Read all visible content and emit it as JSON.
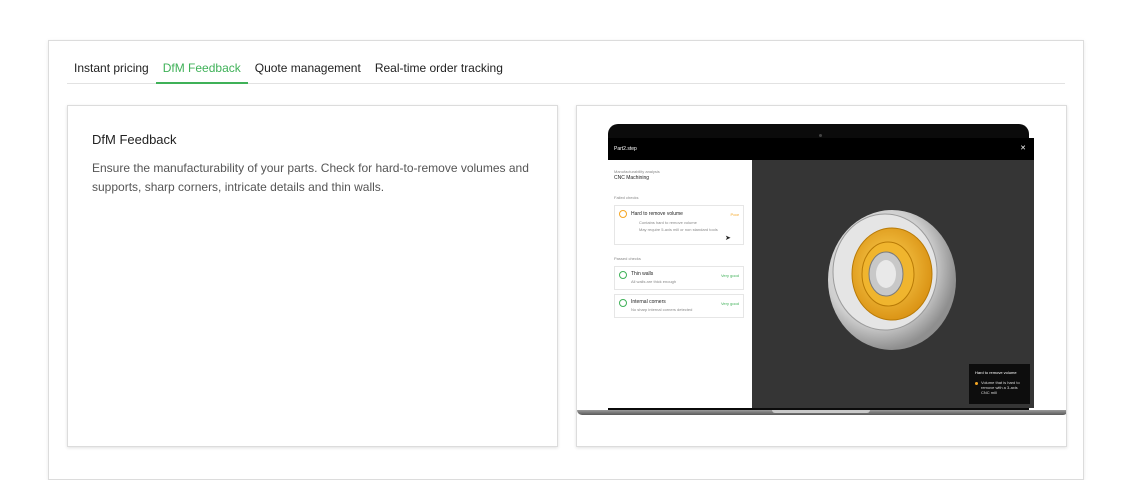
{
  "tabs": [
    {
      "label": "Instant pricing",
      "active": false
    },
    {
      "label": "DfM Feedback",
      "active": true
    },
    {
      "label": "Quote management",
      "active": false
    },
    {
      "label": "Real-time order tracking",
      "active": false
    }
  ],
  "feature": {
    "title": "DfM Feedback",
    "description": "Ensure the manufacturability of your parts. Check for hard-to-remove volumes and supports, sharp corners, intricate details and thin walls."
  },
  "app": {
    "file_name": "Part2.step",
    "analysis_label": "Manufacturability analysis",
    "process": "CNC Machining",
    "failed_header": "Failed checks",
    "failed": {
      "title": "Hard to remove volume",
      "status": "Poor",
      "notes": [
        "Contains hard to remove volume",
        "May require 5-axis mill or non standard tools"
      ]
    },
    "passed_header": "Passed checks",
    "passed": [
      {
        "title": "Thin walls",
        "desc": "All walls are thick enough",
        "status": "Very good"
      },
      {
        "title": "Internal corners",
        "desc": "No sharp internal corners detected",
        "status": "Very good"
      }
    ],
    "legend": {
      "title": "Hard to remove volume",
      "item": "Volume that is hard to remove with a 3-axis CNC mill"
    }
  },
  "colors": {
    "accent": "#3fb158",
    "warning": "#f5a623",
    "part": "#f2b632"
  }
}
